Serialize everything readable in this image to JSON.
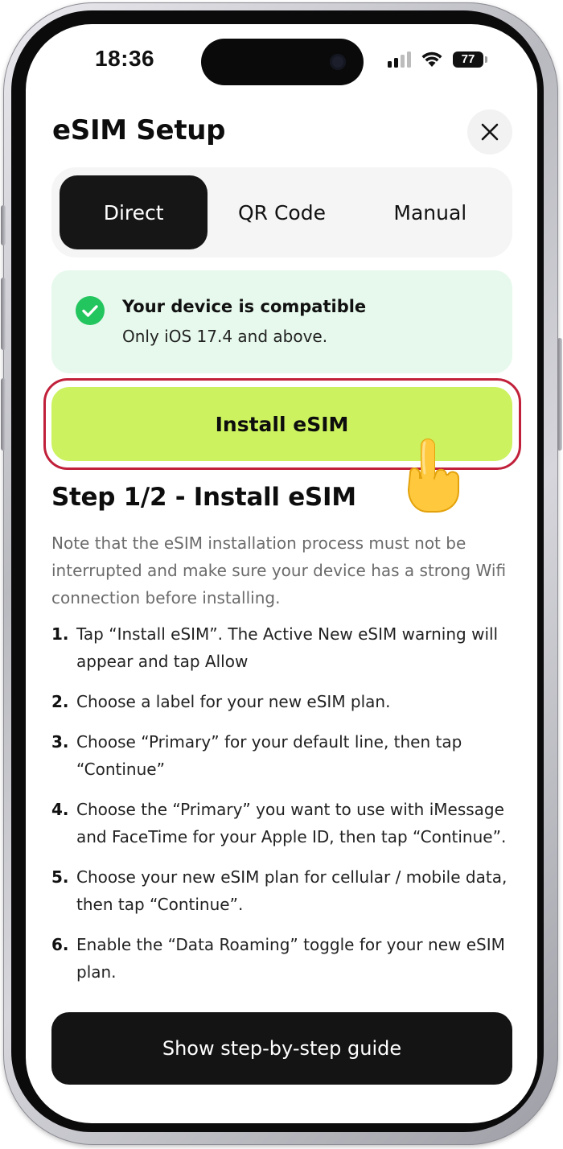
{
  "status_bar": {
    "time": "18:36",
    "battery": "77",
    "signal_bars_active": 2,
    "signal_bars_total": 4
  },
  "header": {
    "title": "eSIM Setup",
    "close_icon": "close-icon"
  },
  "tabs": [
    {
      "label": "Direct",
      "active": true
    },
    {
      "label": "QR Code",
      "active": false
    },
    {
      "label": "Manual",
      "active": false
    }
  ],
  "compat": {
    "icon": "check-circle-icon",
    "title": "Your device is compatible",
    "subtitle": "Only iOS 17.4 and above."
  },
  "install_button": {
    "label": "Install eSIM",
    "pointer_icon": "pointing-hand-icon"
  },
  "step": {
    "title": "Step 1/2 - Install eSIM",
    "note": "Note that the eSIM installation process must not be interrupted and make sure your device has a strong Wifi connection before installing.",
    "items": [
      {
        "num": "1.",
        "text": "Tap “Install eSIM”. The Active New eSIM warning will appear and tap Allow"
      },
      {
        "num": "2.",
        "text": "Choose a label for your new eSIM plan."
      },
      {
        "num": "3.",
        "text": "Choose “Primary” for your default line, then tap “Continue”"
      },
      {
        "num": "4.",
        "text": "Choose the “Primary” you want to use with iMessage and FaceTime for your Apple ID, then tap “Continue”."
      },
      {
        "num": "5.",
        "text": "Choose your new eSIM plan for cellular / mobile data, then tap “Continue”."
      },
      {
        "num": "6.",
        "text": "Enable the “Data Roaming” toggle for your new eSIM plan."
      }
    ]
  },
  "guide_button": {
    "label": "Show step-by-step guide"
  },
  "colors": {
    "accent_green": "#ccf25f",
    "compat_bg": "#e6f9ec",
    "check_green": "#22c55e",
    "highlight_red": "#c1203a",
    "dark": "#141414"
  }
}
